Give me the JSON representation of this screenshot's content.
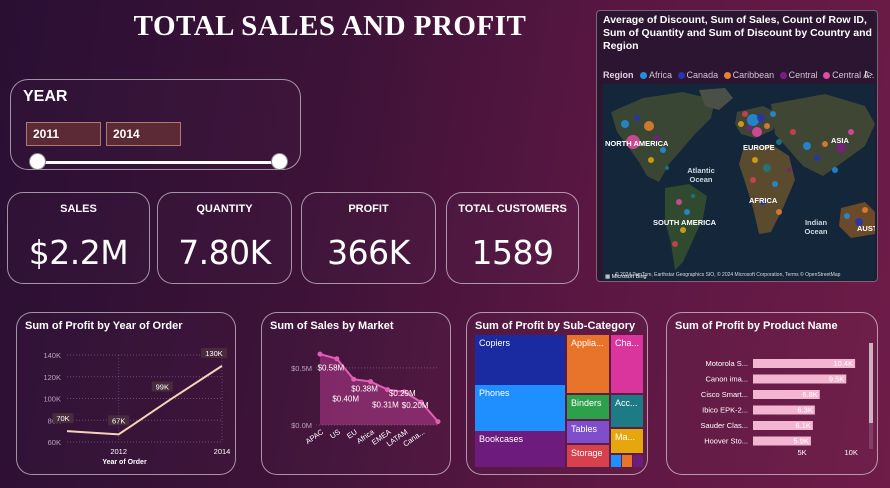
{
  "page_title": "TOTAL SALES AND PROFIT",
  "year_slicer": {
    "label": "YEAR",
    "start": "2011",
    "end": "2014"
  },
  "kpis": [
    {
      "label": "SALES",
      "value": "$2.2M"
    },
    {
      "label": "QUANTITY",
      "value": "7.80K"
    },
    {
      "label": "PROFIT",
      "value": "366K"
    },
    {
      "label": "TOTAL CUSTOMERS",
      "value": "1589"
    }
  ],
  "map": {
    "title": "Average of Discount, Sum of Sales, Count of Row ID, Sum of Quantity and Sum of Discount by Country and Region",
    "legend_label": "Region",
    "legend_items": [
      {
        "name": "Africa",
        "color": "#1f8fe0"
      },
      {
        "name": "Canada",
        "color": "#2334b5"
      },
      {
        "name": "Caribbean",
        "color": "#e8812f"
      },
      {
        "name": "Central",
        "color": "#7a1d82"
      },
      {
        "name": "Central A...",
        "color": "#e34aa2"
      }
    ],
    "labels": {
      "north_america": "NORTH AMERICA",
      "europe": "EUROPE",
      "asia": "ASIA",
      "atlantic": "Atlantic Ocean",
      "africa": "AFRICA",
      "south_america": "SOUTH AMERICA",
      "indian": "Indian Ocean",
      "australia": "AUST"
    },
    "attribution": "© 2024 TomTom, Earthstar Geographics SIO, © 2024 Microsoft Corporation, Terms © OpenStreetMap",
    "provider": "Microsoft Bing"
  },
  "charts": {
    "profit_by_year": {
      "title": "Sum of Profit by Year of Order",
      "chart_data": {
        "type": "line",
        "x": [
          2011,
          2012,
          2013,
          2014
        ],
        "y": [
          70000,
          67000,
          99000,
          130000
        ],
        "data_labels": [
          "70K",
          "67K",
          "99K",
          "130K"
        ],
        "xlabel": "Year of Order",
        "x_ticks": [
          "2012",
          "2014"
        ],
        "y_ticks": [
          "60K",
          "80K",
          "100K",
          "120K",
          "140K"
        ],
        "ylim": [
          60000,
          140000
        ]
      }
    },
    "sales_by_market": {
      "title": "Sum of Sales by Market",
      "chart_data": {
        "type": "area",
        "categories": [
          "APAC",
          "US",
          "EU",
          "Africa",
          "EMEA",
          "LATAM",
          "Cana..."
        ],
        "values": [
          0.62,
          0.58,
          0.4,
          0.38,
          0.31,
          0.29,
          0.2,
          0.03
        ],
        "data_labels": [
          "$0.58M",
          "$0.40M",
          "$0.38M",
          "$0.31M",
          "$0.29M",
          "$0.20M"
        ],
        "y_ticks": [
          "$0.0M",
          "$0.5M"
        ],
        "ylim": [
          0,
          0.7
        ]
      }
    },
    "profit_by_subcategory": {
      "title": "Sum of Profit by Sub-Category",
      "chart_data": {
        "type": "treemap",
        "items": [
          {
            "name": "Copiers",
            "color": "#1a2aa0"
          },
          {
            "name": "Phones",
            "color": "#1f8fff"
          },
          {
            "name": "Bookcases",
            "color": "#6e1b7e"
          },
          {
            "name": "Applia...",
            "color": "#e8742b"
          },
          {
            "name": "Cha...",
            "color": "#d9359d"
          },
          {
            "name": "Binders",
            "color": "#2da04b"
          },
          {
            "name": "Acc...",
            "color": "#1d7b86"
          },
          {
            "name": "Tables",
            "color": "#7f4fcb"
          },
          {
            "name": "Ma...",
            "color": "#e5a60e"
          },
          {
            "name": "Storage",
            "color": "#d7414d"
          }
        ]
      }
    },
    "profit_by_product": {
      "title": "Sum of Profit by Product Name",
      "chart_data": {
        "type": "bar",
        "categories": [
          "Motorola S...",
          "Canon ima...",
          "Cisco Smart...",
          "Ibico EPK-2...",
          "Sauder Clas...",
          "Hoover Sto..."
        ],
        "values": [
          10.4,
          9.5,
          6.8,
          6.3,
          6.1,
          5.9
        ],
        "data_labels": [
          "10.4K",
          "9.5K",
          "6.8K",
          "6.3K",
          "6.1K",
          "5.9K"
        ],
        "x_ticks": [
          "5K",
          "10K"
        ],
        "xlim": [
          0,
          11
        ]
      }
    }
  }
}
